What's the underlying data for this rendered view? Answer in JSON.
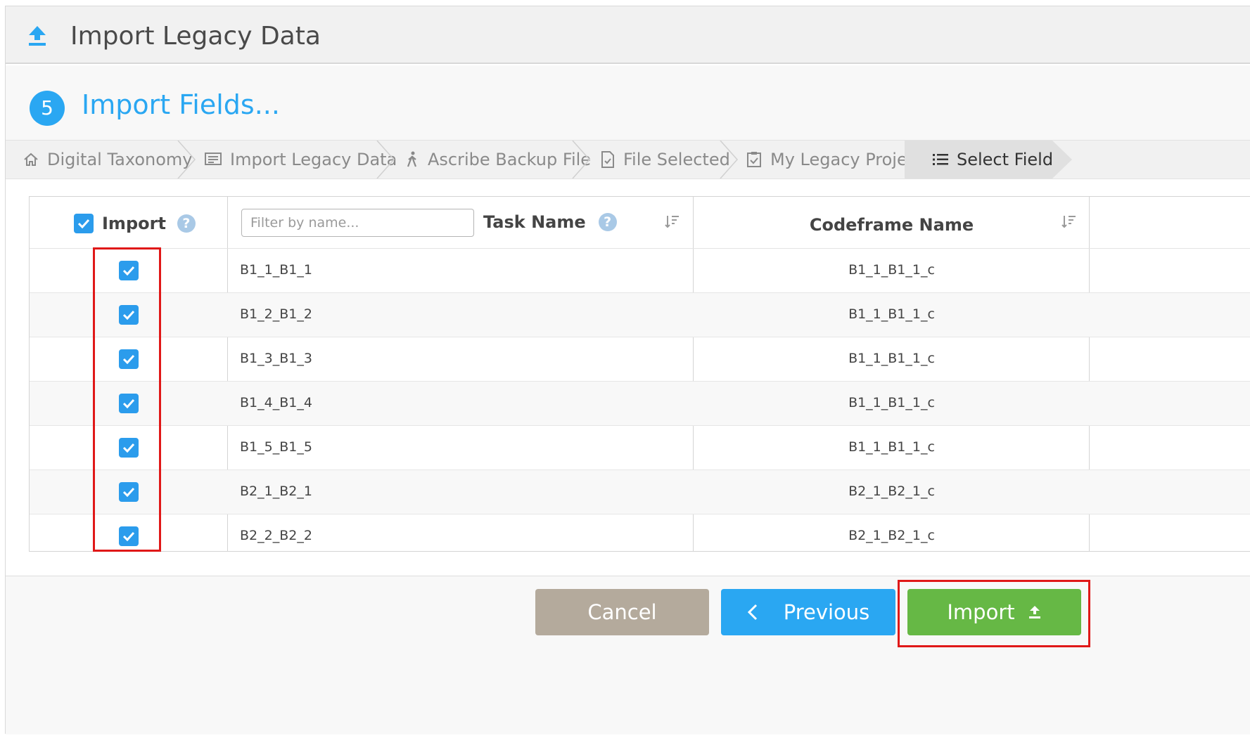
{
  "dialog": {
    "title": "Import Legacy Data",
    "title_icon": "upload-icon"
  },
  "step": {
    "number": "5",
    "title": "Import Fields..."
  },
  "breadcrumb": [
    {
      "label": "Digital Taxonomy",
      "icon": "home-icon"
    },
    {
      "label": "Import Legacy Data",
      "icon": "list-box-icon"
    },
    {
      "label": "Ascribe Backup File",
      "icon": "walking-person-icon"
    },
    {
      "label": "File Selected",
      "icon": "file-check-icon"
    },
    {
      "label": "My Legacy Project",
      "icon": "clipboard-check-icon"
    },
    {
      "label": "Select Fields",
      "icon": "list-icon",
      "active": true
    }
  ],
  "table": {
    "import_header": "Import",
    "filter_placeholder": "Filter by name...",
    "filter_value": "",
    "task_header": "Task Name",
    "codeframe_header": "Codeframe Name",
    "select_all_checked": true,
    "rows": [
      {
        "checked": true,
        "task": "B1_1_B1_1",
        "codeframe": "B1_1_B1_1_c"
      },
      {
        "checked": true,
        "task": "B1_2_B1_2",
        "codeframe": "B1_1_B1_1_c"
      },
      {
        "checked": true,
        "task": "B1_3_B1_3",
        "codeframe": "B1_1_B1_1_c"
      },
      {
        "checked": true,
        "task": "B1_4_B1_4",
        "codeframe": "B1_1_B1_1_c"
      },
      {
        "checked": true,
        "task": "B1_5_B1_5",
        "codeframe": "B1_1_B1_1_c"
      },
      {
        "checked": true,
        "task": "B2_1_B2_1",
        "codeframe": "B2_1_B2_1_c"
      },
      {
        "checked": true,
        "task": "B2_2_B2_2",
        "codeframe": "B2_1_B2_1_c"
      }
    ]
  },
  "footer": {
    "cancel_label": "Cancel",
    "previous_label": "Previous",
    "import_label": "Import"
  },
  "colors": {
    "accent": "#2aa7f2",
    "checkbox": "#2b9cec",
    "cancel": "#b4aa9c",
    "import": "#66b845",
    "highlight": "#e01818"
  }
}
